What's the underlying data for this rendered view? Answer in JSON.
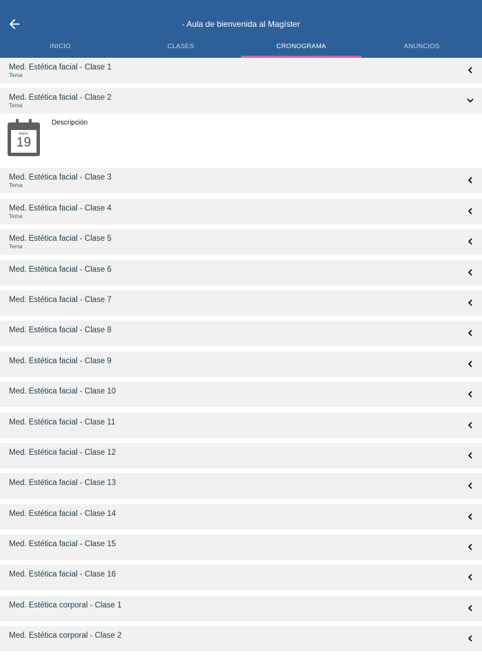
{
  "header": {
    "title": "- Aula de bienvenida al Magíster",
    "back_icon": "arrow-left-icon"
  },
  "tabs": [
    {
      "label": "INICIO",
      "active": false
    },
    {
      "label": "CLASES",
      "active": false
    },
    {
      "label": "CRONOGRAMA",
      "active": true
    },
    {
      "label": "ANUNCIOS",
      "active": false
    }
  ],
  "colors": {
    "app_bar": "#2d6098",
    "tab_indicator": "#e25d97",
    "row_bg": "#f1f1f1"
  },
  "schedule": {
    "items": [
      {
        "title": "Med. Estética facial - Clase 1",
        "subtitle": "Tema",
        "expanded": false
      },
      {
        "title": "Med. Estética facial - Clase 2",
        "subtitle": "Tema",
        "expanded": true
      },
      {
        "title": "Med. Estética facial - Clase 3",
        "subtitle": "Tema",
        "expanded": false
      },
      {
        "title": "Med. Estética facial - Clase 4",
        "subtitle": "Tema",
        "expanded": false
      },
      {
        "title": "Med. Estética facial - Clase 5",
        "subtitle": "Tema",
        "expanded": false
      },
      {
        "title": "Med. Estética facial - Clase 6",
        "subtitle": "",
        "expanded": false
      },
      {
        "title": "Med. Estética facial - Clase 7",
        "subtitle": "",
        "expanded": false
      },
      {
        "title": "Med. Estética facial - Clase 8",
        "subtitle": "",
        "expanded": false
      },
      {
        "title": "Med. Estética facial - Clase 9",
        "subtitle": "",
        "expanded": false
      },
      {
        "title": "Med. Estética facial - Clase 10",
        "subtitle": "",
        "expanded": false
      },
      {
        "title": "Med. Estética facial - Clase 11",
        "subtitle": "",
        "expanded": false
      },
      {
        "title": "Med. Estética facial - Clase 12",
        "subtitle": "",
        "expanded": false
      },
      {
        "title": "Med. Estética facial - Clase 13",
        "subtitle": "",
        "expanded": false
      },
      {
        "title": "Med. Estética facial - Clase 14",
        "subtitle": "",
        "expanded": false
      },
      {
        "title": "Med. Estética facial - Clase 15",
        "subtitle": "",
        "expanded": false
      },
      {
        "title": "Med. Estética facial - Clase 16",
        "subtitle": "",
        "expanded": false
      },
      {
        "title": "Med. Estética corporal - Clase 1",
        "subtitle": "",
        "expanded": false
      },
      {
        "title": "Med. Estética corporal - Clase 2",
        "subtitle": "",
        "expanded": false
      }
    ],
    "detail": {
      "icon": "calendar-icon",
      "month": "ABRIL",
      "day": "19",
      "description_label": "Descripción"
    }
  }
}
